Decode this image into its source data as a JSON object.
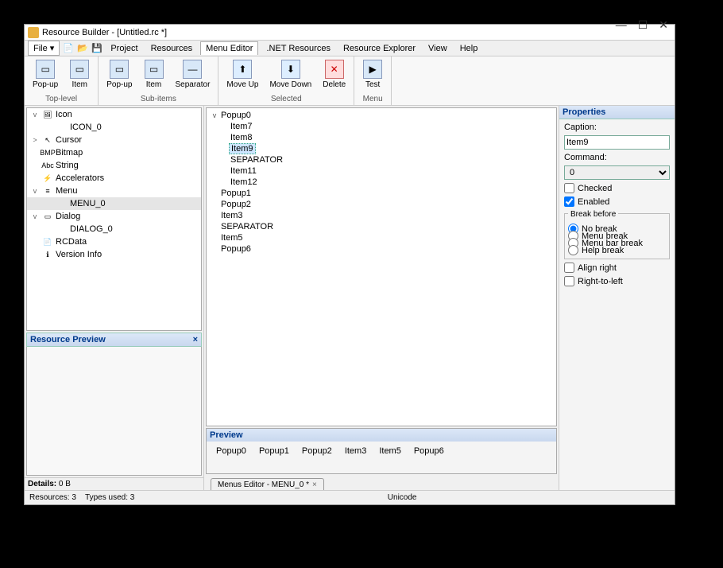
{
  "window": {
    "title": "Resource Builder - [Untitled.rc *]"
  },
  "menubar": {
    "file": "File",
    "project": "Project",
    "resources": "Resources",
    "menu_editor": "Menu Editor",
    "net_resources": ".NET Resources",
    "resource_explorer": "Resource Explorer",
    "view": "View",
    "help": "Help"
  },
  "ribbon": {
    "groups": {
      "toplevel": {
        "label": "Top-level",
        "popup": "Pop-up",
        "item": "Item"
      },
      "subitems": {
        "label": "Sub-items",
        "popup": "Pop-up",
        "item": "Item",
        "separator": "Separator"
      },
      "selected": {
        "label": "Selected",
        "moveup": "Move Up",
        "movedown": "Move Down",
        "delete": "Delete"
      },
      "menu": {
        "label": "Menu",
        "test": "Test"
      }
    }
  },
  "resource_tree": [
    {
      "level": 1,
      "exp": "v",
      "icon": "🖼",
      "label": "Icon"
    },
    {
      "level": 2,
      "exp": "",
      "icon": "",
      "label": "ICON_0"
    },
    {
      "level": 1,
      "exp": ">",
      "icon": "↖",
      "label": "Cursor"
    },
    {
      "level": 1,
      "exp": "",
      "icon": "BMP",
      "label": "Bitmap"
    },
    {
      "level": 1,
      "exp": "",
      "icon": "Abc",
      "label": "String"
    },
    {
      "level": 1,
      "exp": "",
      "icon": "⚡",
      "label": "Accelerators"
    },
    {
      "level": 1,
      "exp": "v",
      "icon": "≡",
      "label": "Menu"
    },
    {
      "level": 2,
      "exp": "",
      "icon": "",
      "label": "MENU_0",
      "selected": true
    },
    {
      "level": 1,
      "exp": "v",
      "icon": "▭",
      "label": "Dialog"
    },
    {
      "level": 2,
      "exp": "",
      "icon": "",
      "label": "DIALOG_0"
    },
    {
      "level": 1,
      "exp": "",
      "icon": "📄",
      "label": "RCData"
    },
    {
      "level": 1,
      "exp": "",
      "icon": "ℹ",
      "label": "Version Info"
    }
  ],
  "resource_preview": {
    "title": "Resource Preview"
  },
  "details": {
    "label": "Details:",
    "size": "0 B"
  },
  "menu_tree": [
    {
      "level": 0,
      "exp": "v",
      "label": "Popup0"
    },
    {
      "level": 1,
      "exp": "",
      "label": "Item7"
    },
    {
      "level": 1,
      "exp": "",
      "label": "Item8"
    },
    {
      "level": 1,
      "exp": "",
      "label": "Item9",
      "selected": true
    },
    {
      "level": 1,
      "exp": "",
      "label": "SEPARATOR"
    },
    {
      "level": 1,
      "exp": "",
      "label": "Item11"
    },
    {
      "level": 1,
      "exp": "",
      "label": "Item12"
    },
    {
      "level": 0,
      "exp": "",
      "label": "Popup1"
    },
    {
      "level": 0,
      "exp": "",
      "label": "Popup2"
    },
    {
      "level": 0,
      "exp": "",
      "label": "Item3"
    },
    {
      "level": 0,
      "exp": "",
      "label": "SEPARATOR"
    },
    {
      "level": 0,
      "exp": "",
      "label": "Item5"
    },
    {
      "level": 0,
      "exp": "",
      "label": "Popup6"
    }
  ],
  "center_preview": {
    "title": "Preview",
    "items": [
      "Popup0",
      "Popup1",
      "Popup2",
      "Item3",
      "Item5",
      "Popup6"
    ]
  },
  "center_tab": {
    "label": "Menus Editor - MENU_0 *"
  },
  "properties": {
    "title": "Properties",
    "caption_label": "Caption:",
    "caption_value": "Item9",
    "command_label": "Command:",
    "command_value": "0",
    "checked": "Checked",
    "enabled": "Enabled",
    "break_before": "Break before",
    "no_break": "No break",
    "menu_break": "Menu break",
    "menu_bar_break": "Menu bar break",
    "help_break": "Help break",
    "align_right": "Align right",
    "rtl": "Right-to-left"
  },
  "statusbar": {
    "resources": "Resources: 3",
    "types": "Types used: 3",
    "encoding": "Unicode"
  }
}
